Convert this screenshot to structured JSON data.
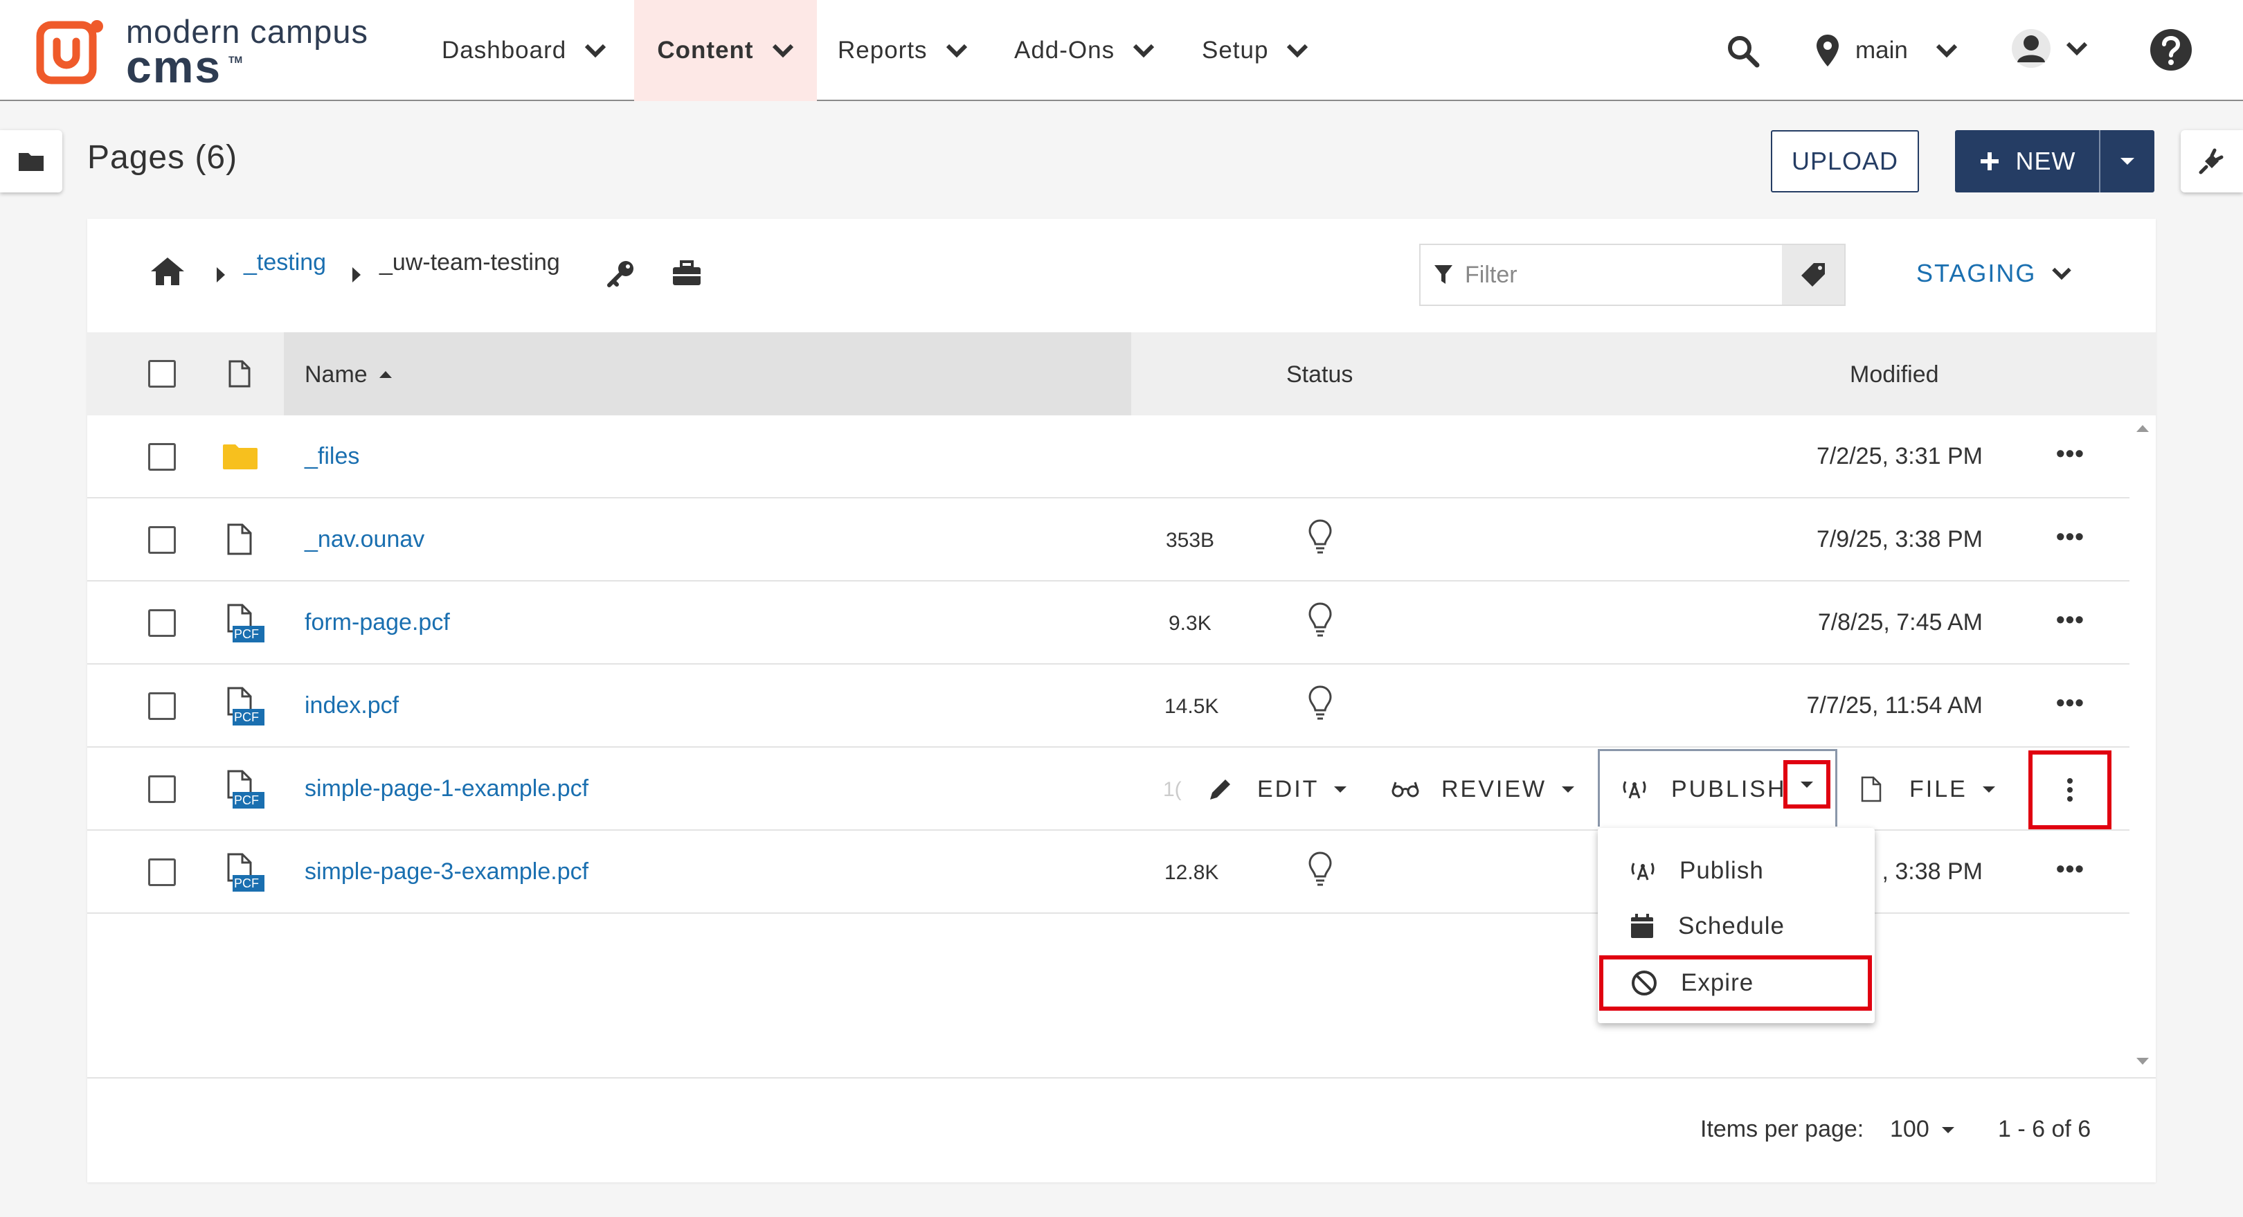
{
  "brand": {
    "line1": "modern campus",
    "line2": "cms",
    "tm": "TM",
    "accent": "#ef5a2a"
  },
  "nav": [
    {
      "label": "Dashboard",
      "active": false
    },
    {
      "label": "Content",
      "active": true
    },
    {
      "label": "Reports",
      "active": false
    },
    {
      "label": "Add-Ons",
      "active": false
    },
    {
      "label": "Setup",
      "active": false
    }
  ],
  "header": {
    "site": "main"
  },
  "page": {
    "title": "Pages (6)",
    "upload_label": "UPLOAD",
    "new_label": "NEW"
  },
  "breadcrumb": {
    "item1": "_testing",
    "item2": "_uw-team-testing"
  },
  "filter": {
    "placeholder": "Filter"
  },
  "environment": {
    "label": "STAGING"
  },
  "table": {
    "headers": {
      "name": "Name",
      "status": "Status",
      "modified": "Modified"
    },
    "rows": [
      {
        "name": "_files",
        "size": "",
        "modified": "7/2/25, 3:31 PM",
        "type": "folder"
      },
      {
        "name": "_nav.ounav",
        "size": "353B",
        "modified": "7/9/25, 3:38 PM",
        "type": "file"
      },
      {
        "name": "form-page.pcf",
        "size": "9.3K",
        "modified": "7/8/25, 7:45 AM",
        "type": "pcf"
      },
      {
        "name": "index.pcf",
        "size": "14.5K",
        "modified": "7/7/25, 11:54 AM",
        "type": "pcf"
      },
      {
        "name": "simple-page-1-example.pcf",
        "size": "1(",
        "modified": "",
        "type": "pcf"
      },
      {
        "name": "simple-page-3-example.pcf",
        "size": "12.8K",
        "modified": ", 3:38 PM",
        "type": "pcf"
      }
    ],
    "pcf_badge": "PCF"
  },
  "row_actions": {
    "edit": "EDIT",
    "review": "REVIEW",
    "publish": "PUBLISH",
    "file": "FILE"
  },
  "publish_menu": {
    "publish": "Publish",
    "schedule": "Schedule",
    "expire": "Expire"
  },
  "pagination": {
    "label": "Items per page:",
    "per_page": "100",
    "range": "1 - 6 of 6"
  },
  "colors": {
    "link": "#1a6fb0",
    "primary": "#253d64",
    "highlight": "#e00010"
  }
}
